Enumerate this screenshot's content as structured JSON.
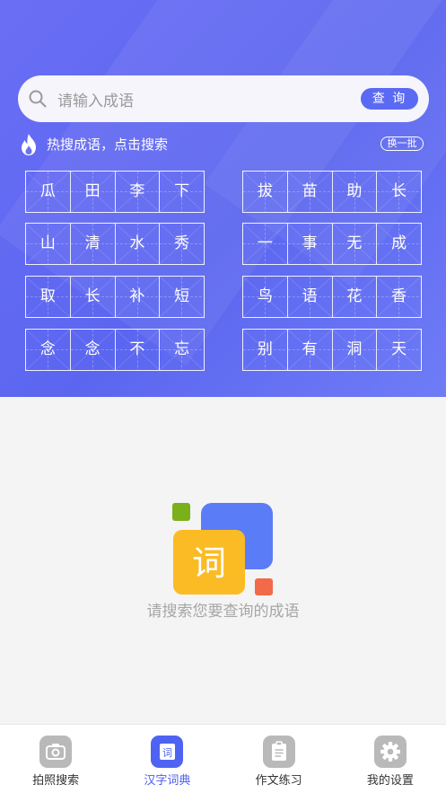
{
  "search": {
    "placeholder": "请输入成语",
    "button_label": "查 询"
  },
  "hot": {
    "label": "热搜成语，点击搜索",
    "refresh_label": "换一批"
  },
  "idioms": [
    [
      "瓜",
      "田",
      "李",
      "下"
    ],
    [
      "拔",
      "苗",
      "助",
      "长"
    ],
    [
      "山",
      "清",
      "水",
      "秀"
    ],
    [
      "一",
      "事",
      "无",
      "成"
    ],
    [
      "取",
      "长",
      "补",
      "短"
    ],
    [
      "鸟",
      "语",
      "花",
      "香"
    ],
    [
      "念",
      "念",
      "不",
      "忘"
    ],
    [
      "别",
      "有",
      "洞",
      "天"
    ]
  ],
  "empty": {
    "illus_char": "词",
    "message": "请搜索您要查询的成语"
  },
  "tabs": [
    {
      "label": "拍照搜索",
      "icon": "camera-icon"
    },
    {
      "label": "汉字词典",
      "icon": "dictionary-icon",
      "active": true
    },
    {
      "label": "作文练习",
      "icon": "notebook-icon"
    },
    {
      "label": "我的设置",
      "icon": "gear-icon"
    }
  ],
  "colors": {
    "header": "#5b66f0",
    "accent": "#5b6af2",
    "active_tab": "#4c5ff0",
    "empty_text": "#a6a6a6"
  }
}
